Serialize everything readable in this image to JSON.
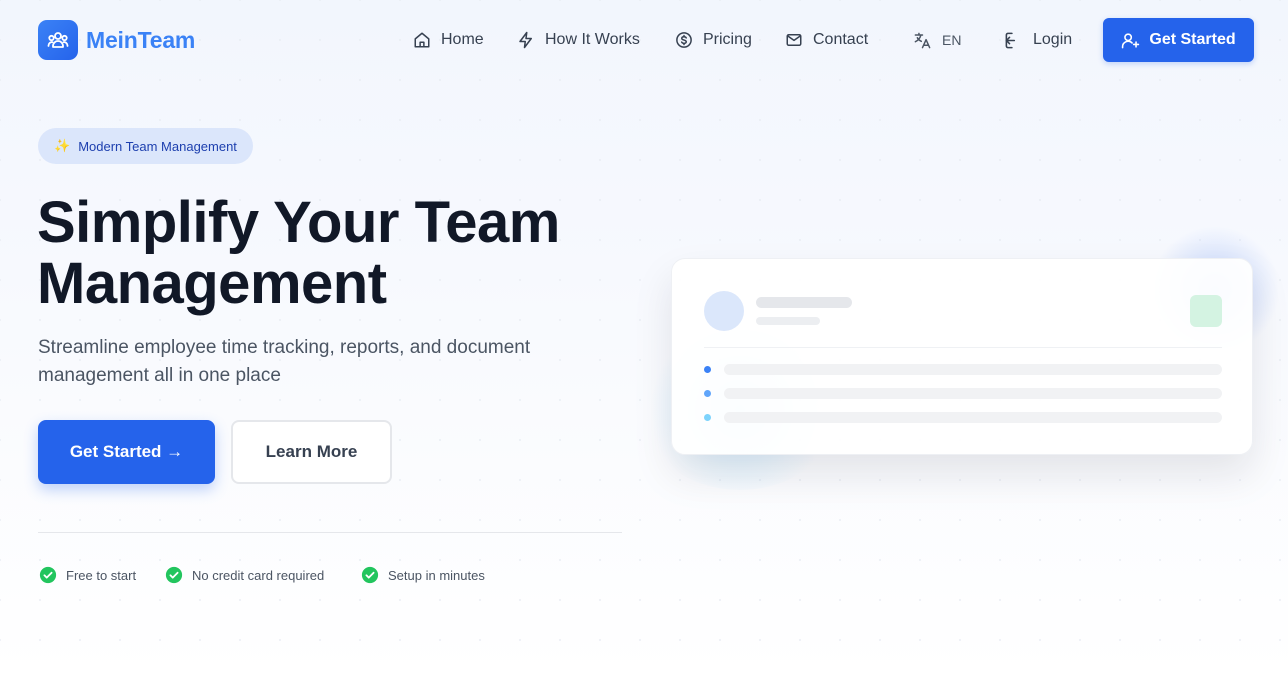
{
  "brand": {
    "name": "MeinTeam"
  },
  "nav": {
    "items": [
      {
        "label": "Home",
        "icon": "home-icon"
      },
      {
        "label": "How It Works",
        "icon": "lightning-icon"
      },
      {
        "label": "Pricing",
        "icon": "dollar-icon"
      },
      {
        "label": "Contact",
        "icon": "mail-icon"
      }
    ],
    "language": "EN",
    "login": "Login",
    "cta": "Get Started"
  },
  "hero": {
    "badge": "Modern Team Management",
    "title_line1": "Simplify Your Team",
    "title_line2": "Management",
    "subtitle": "Streamline employee time tracking, reports, and document management all in one place",
    "primary_button": "Get Started →",
    "secondary_button": "Learn More",
    "features": [
      "Free to start",
      "No credit card required",
      "Setup in minutes"
    ]
  },
  "colors": {
    "primary": "#2563eb",
    "brand_text": "#3b82f6",
    "success": "#22c55e",
    "badge_bg": "#dbe6fb"
  }
}
